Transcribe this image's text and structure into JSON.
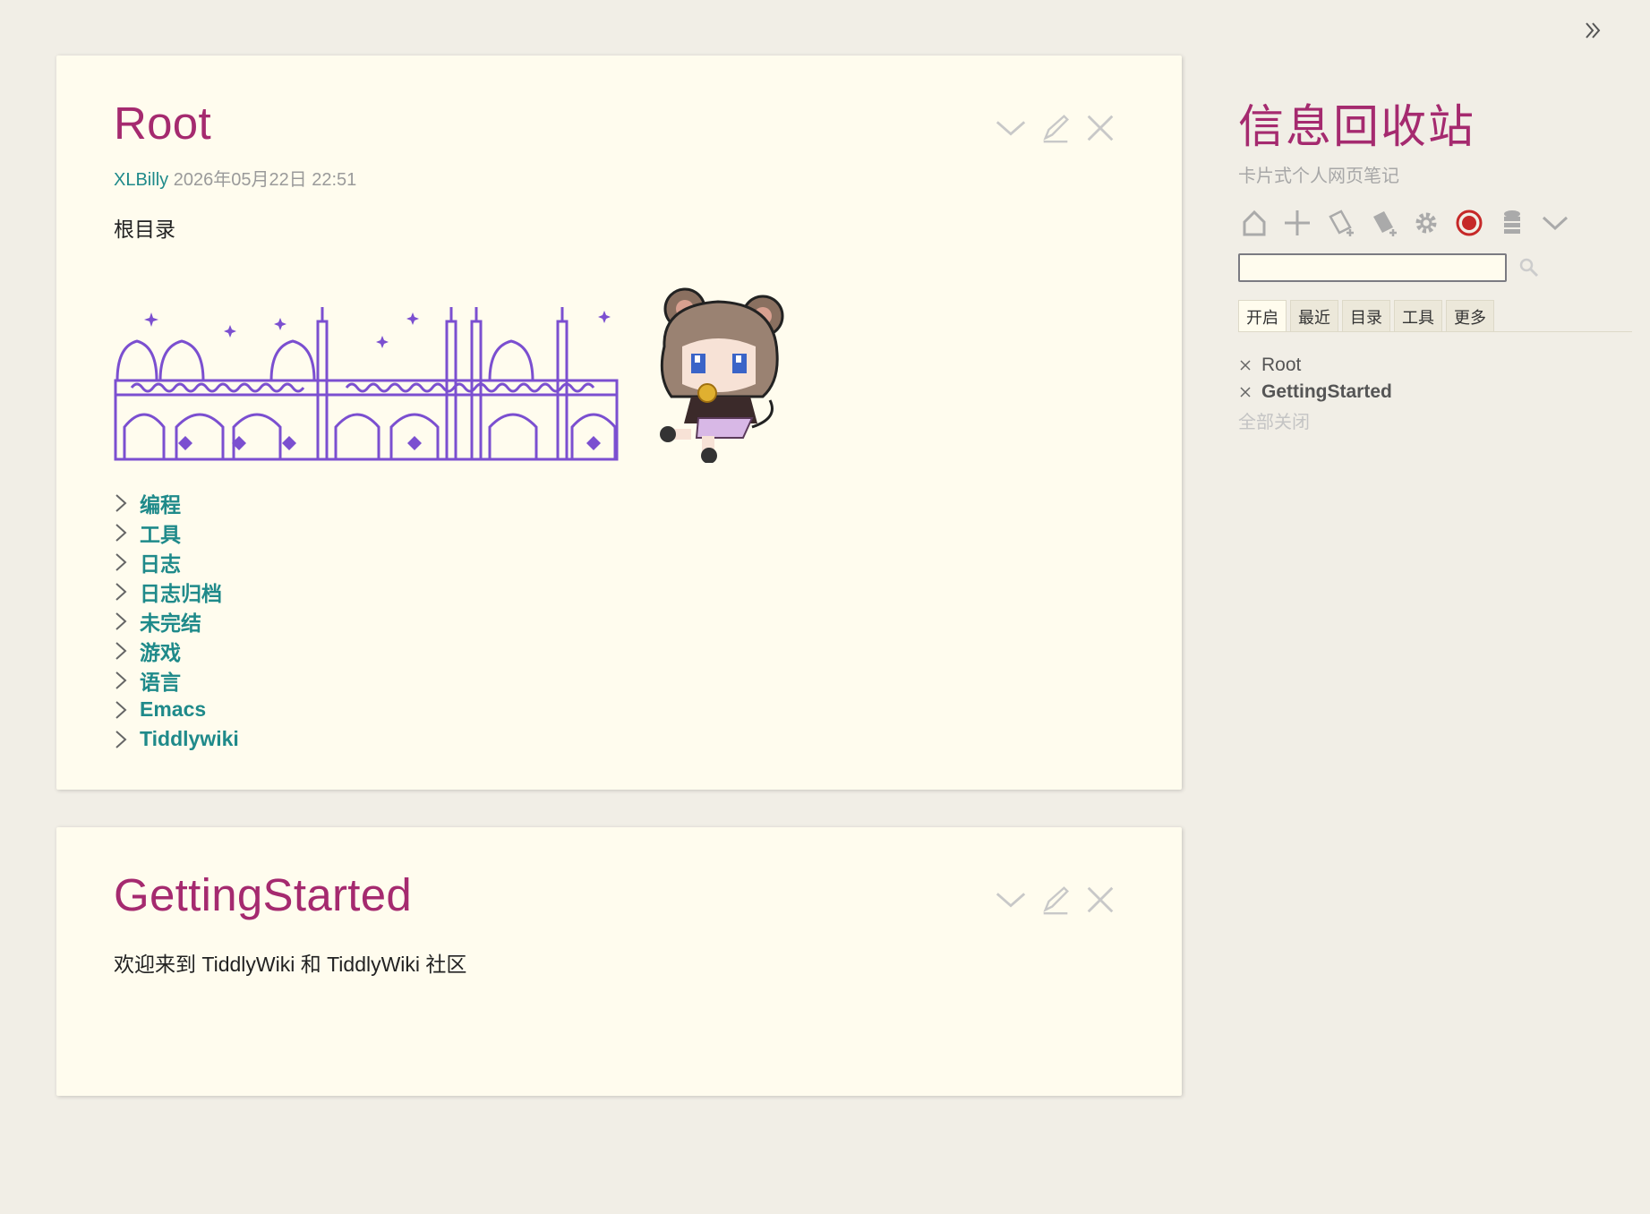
{
  "sidebar": {
    "title": "信息回收站",
    "subtitle": "卡片式个人网页笔记",
    "search": {
      "value": "",
      "placeholder": ""
    },
    "tabs": [
      "开启",
      "最近",
      "目录",
      "工具",
      "更多"
    ],
    "active_tab": "开启",
    "open_tiddlers": [
      "Root",
      "GettingStarted"
    ],
    "close_all_label": "全部关闭",
    "page_controls": [
      "home-icon",
      "new-tiddler-icon",
      "new-journal-icon",
      "import-icon",
      "control-panel-icon",
      "record-icon",
      "storage-icon",
      "more-icon"
    ]
  },
  "tiddlers": [
    {
      "title": "Root",
      "author": "XLBilly",
      "date": "2026年05月22日 22:51",
      "intro": "根目录",
      "toc": [
        "编程",
        "工具",
        "日志",
        "日志归档",
        "未完结",
        "游戏",
        "语言",
        "Emacs",
        "Tiddlywiki"
      ]
    },
    {
      "title": "GettingStarted",
      "intro": "欢迎来到 TiddlyWiki 和 TiddlyWiki 社区"
    }
  ],
  "colors": {
    "title": "#a52a6f",
    "link": "#1f8a8a",
    "page_bg": "#f1eee6",
    "tiddler_bg": "#fffcee",
    "banner": "#7b4fd0",
    "record": "#c62828"
  }
}
